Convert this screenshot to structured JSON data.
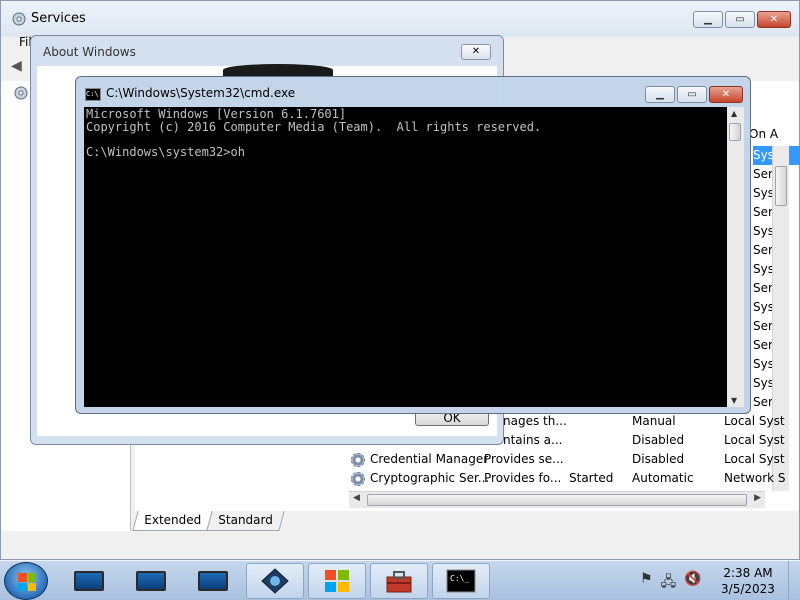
{
  "services": {
    "title": "Services",
    "menu_file": "Fil",
    "column_header": "On A",
    "right_stripe": [
      "Syst",
      "Serv",
      "Syst",
      "Serv",
      "Syst",
      "Serv",
      "Syst",
      "Serv",
      "Syst",
      "Serv",
      "Serv",
      "Syst",
      "Syst",
      "Serv"
    ],
    "rows": [
      {
        "name": "",
        "description": "nages th...",
        "status": "",
        "startup": "Manual",
        "logon": "Local Syst"
      },
      {
        "name": "",
        "description": "ntains a...",
        "status": "",
        "startup": "Disabled",
        "logon": "Local Syst"
      },
      {
        "name": "Credential Manager",
        "description": "Provides se...",
        "status": "",
        "startup": "Disabled",
        "logon": "Local Syst"
      },
      {
        "name": "Cryptographic Ser...",
        "description": "Provides fo...",
        "status": "Started",
        "startup": "Automatic",
        "logon": "Network S"
      }
    ],
    "tabs": [
      "Extended",
      "Standard"
    ]
  },
  "about": {
    "title": "About Windows",
    "ok_label": "OK"
  },
  "cmd": {
    "title": "C:\\Windows\\System32\\cmd.exe",
    "lines": [
      "Microsoft Windows [Version 6.1.7601]",
      "Copyright (c) 2016 Computer Media (Team).  All rights reserved.",
      "",
      "C:\\Windows\\system32>oh"
    ]
  },
  "taskbar": {
    "time": "2:38 AM",
    "date": "3/5/2023",
    "icons": [
      "monitor-icon",
      "monitor-icon",
      "monitor-icon",
      "network-icon",
      "windows-explorer-icon",
      "toolbox-icon",
      "cmd-icon"
    ]
  }
}
